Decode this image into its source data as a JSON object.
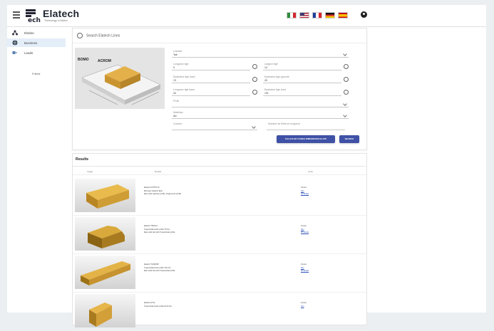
{
  "header": {
    "logo_text": "Elatech",
    "logo_mark_text": "ech",
    "logo_tagline": "Technology of Motion",
    "flags": [
      {
        "name": "italy-flag",
        "colors": [
          "#2e8b3d",
          "#ffffff",
          "#d5262e"
        ]
      },
      {
        "name": "usa-flag",
        "colors": [
          "#b22234",
          "#ffffff",
          "#3c3b6e"
        ]
      },
      {
        "name": "france-flag",
        "colors": [
          "#1f3f9a",
          "#ffffff",
          "#d9262e"
        ]
      },
      {
        "name": "germany-flag",
        "colors": [
          "#111111",
          "#d9262e",
          "#f2c200"
        ]
      },
      {
        "name": "spain-flag",
        "colors": [
          "#c60b1e",
          "#ffc400",
          "#c60b1e"
        ]
      }
    ]
  },
  "sidebar": {
    "items": [
      {
        "label": "Elatine",
        "icon": "tree-icon"
      },
      {
        "label": "Business",
        "icon": "globe-icon"
      },
      {
        "label": "Leads",
        "icon": "leads-icon"
      }
    ],
    "sub_label": "Friend"
  },
  "search": {
    "title": "Search Elatech Lines",
    "fields": {
      "f1": {
        "label": "Lineaire",
        "value": "Tab"
      },
      "f2": {
        "label": "Longueur tige",
        "value": "0"
      },
      "f3": {
        "label": "Largeur tige",
        "value": "14"
      },
      "f4": {
        "label": "Epaisseur tige base",
        "value": "13"
      },
      "f5": {
        "label": "Epaisseur tige gauche",
        "value": "43"
      },
      "f6": {
        "label": "Longueur tige base",
        "value": "34"
      },
      "f7": {
        "label": "Epaisseur tige haut",
        "value": "101"
      },
      "f8": {
        "label": "Profil",
        "value": ""
      },
      "f9": {
        "label": "Matériau",
        "value": "Alv"
      },
      "f10": {
        "label": "Couleur",
        "value": ""
      },
      "f11": {
        "label": "Nombre de filets en longueur",
        "value": ""
      }
    },
    "buttons": {
      "calc": "CALCULER CODES DIMENSIONS ELATE",
      "search": "SEARCH"
    },
    "diagram_labels": {
      "left": "BOMO",
      "right": "ACROM"
    }
  },
  "results": {
    "title": "Results",
    "columns": [
      "Image",
      "Details",
      "Links"
    ],
    "rows": [
      {
        "lines": [
          "Elatech A3T5T1T4",
          "Belt type: Elatech Elan",
          "Elan solid teardrop profile, single-tooth profile"
        ],
        "links": [
          "Details",
          "Sku",
          "3D Model"
        ]
      },
      {
        "lines": [
          "Elatech T5M1J4",
          "Trapezoidal tooth profile T5 Pro",
          "Elan solid belt with Trapezoidal profile"
        ],
        "links": [
          "Details",
          "Sku",
          "3D Model"
        ]
      },
      {
        "lines": [
          "Elatech T10M4SP",
          "Trapezoidal tooth profile T10 Pro",
          "Elan solid belt with Trapezoidal profile"
        ],
        "links": [
          "Details",
          "Sku",
          "3D Model"
        ]
      },
      {
        "lines": [
          "Elatech AT10",
          "Trapezoidal tooth profile AT10 Pro",
          ""
        ],
        "links": [
          "Details",
          "Sku",
          ""
        ]
      }
    ]
  },
  "colors": {
    "accent": "#3f51a6",
    "sidebar_active": "#e3eef8",
    "link": "#2a4db5",
    "profile_yellow": "#d9a93c"
  }
}
